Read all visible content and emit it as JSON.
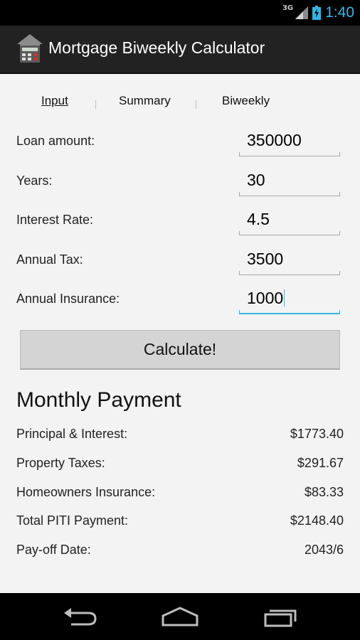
{
  "status_bar": {
    "network_type": "3G",
    "time": "1:40",
    "signal_icon": "signal-icon",
    "battery_icon": "battery-charging-icon",
    "time_color": "#33b5e5"
  },
  "action_bar": {
    "title": "Mortgage Biweekly Calculator",
    "icon": "house-calculator-icon"
  },
  "tabs": [
    {
      "label": "Input",
      "active": true
    },
    {
      "label": "Summary",
      "active": false
    },
    {
      "label": "Biweekly",
      "active": false
    }
  ],
  "inputs": [
    {
      "label": "Loan amount:",
      "value": "350000"
    },
    {
      "label": "Years:",
      "value": "30"
    },
    {
      "label": "Interest Rate:",
      "value": "4.5"
    },
    {
      "label": "Annual Tax:",
      "value": "3500"
    },
    {
      "label": "Annual Insurance:",
      "value": "1000",
      "focused": true
    }
  ],
  "calculate_button": "Calculate!",
  "results": {
    "title": "Monthly Payment",
    "rows": [
      {
        "label": "Principal & Interest:",
        "value": "$1773.40"
      },
      {
        "label": "Property Taxes:",
        "value": "$291.67"
      },
      {
        "label": "Homeowners Insurance:",
        "value": "$83.33"
      },
      {
        "label": "Total PITI Payment:",
        "value": "$2148.40"
      },
      {
        "label": "Pay-off Date:",
        "value": "2043/6"
      }
    ]
  },
  "nav_bar": {
    "back_icon": "back-icon",
    "home_icon": "home-icon",
    "recents_icon": "recent-apps-icon"
  },
  "colors": {
    "accent": "#33b5e5",
    "action_bar_bg": "#222222",
    "content_bg": "#f3f3f3",
    "button_bg": "#d4d4d4"
  }
}
